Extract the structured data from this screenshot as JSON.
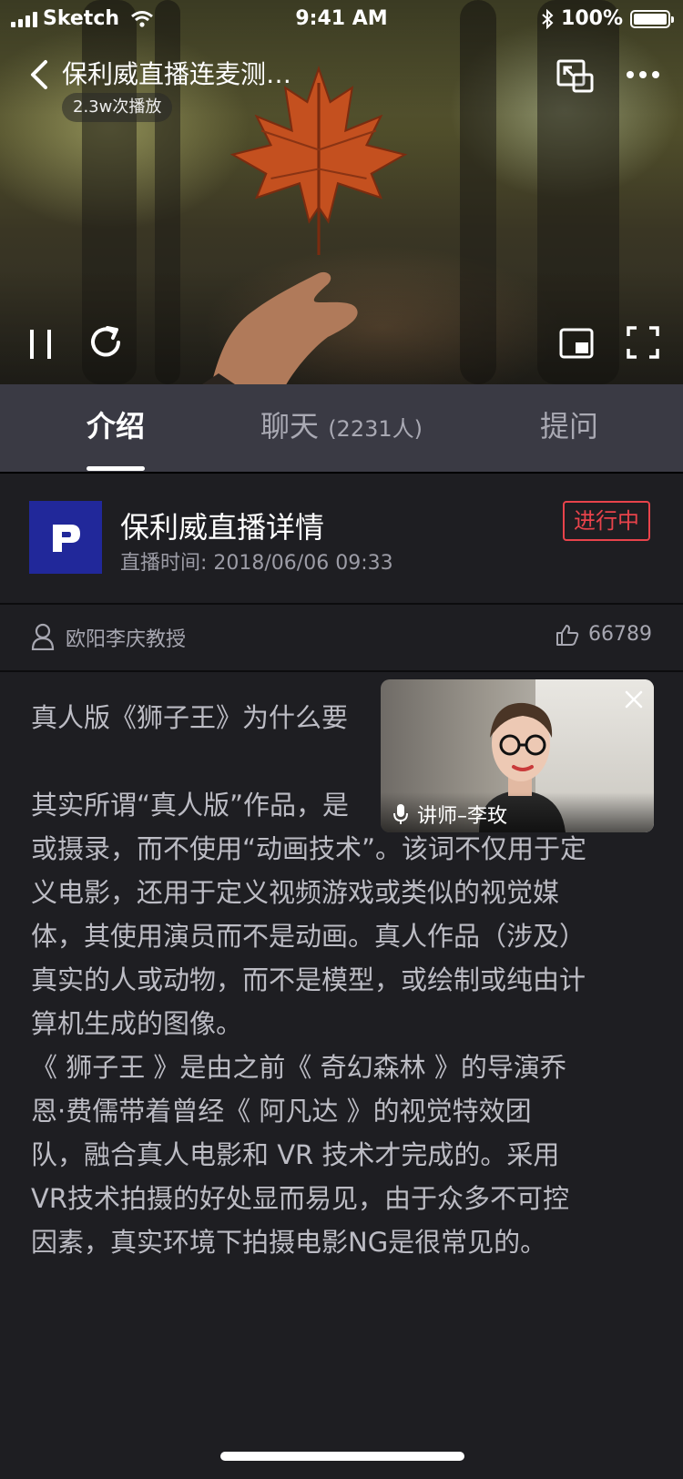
{
  "status_bar": {
    "carrier": "Sketch",
    "time": "9:41 AM",
    "battery": "100%"
  },
  "nav": {
    "title": "保利威直播连麦测…",
    "play_count": "2.3w次播放"
  },
  "tabs": [
    {
      "label": "介绍",
      "sub": ""
    },
    {
      "label": "聊天",
      "sub": "(2231人)"
    },
    {
      "label": "提问",
      "sub": ""
    }
  ],
  "detail": {
    "logo_letter": "P",
    "title": "保利威直播详情",
    "time": "直播时间: 2018/06/06 09:33",
    "status": "进行中"
  },
  "speaker": {
    "name": "欧阳李庆教授",
    "likes": "66789"
  },
  "float_video": {
    "label": "讲师–李玫"
  },
  "article": {
    "lines": [
      "真人版《狮子王》为什么要",
      "",
      "其实所谓“真人版”作品，是",
      "或摄录，而不使用“动画技术”。该词不仅用于定",
      "义电影，还用于定义视频游戏或类似的视觉媒",
      "体，其使用演员而不是动画。真人作品（涉及）",
      "真实的人或动物，而不是模型，或绘制或纯由计",
      "算机生成的图像。",
      "《 狮子王 》是由之前《 奇幻森林 》的导演乔",
      "恩·费儒带着曾经《 阿凡达 》的视觉特效团",
      "队，融合真人电影和 VR 技术才完成的。采用",
      "VR技术拍摄的好处显而易见，由于众多不可控",
      "因素，真实环境下拍摄电影NG是很常见的。"
    ]
  },
  "colors": {
    "accent_red": "#e8434b",
    "logo_blue": "#21289a",
    "tab_bg": "#3a3a44",
    "page_bg": "#1e1e22"
  },
  "icons": [
    "signal-icon",
    "wifi-icon",
    "bluetooth-icon",
    "battery-icon",
    "back-icon",
    "pip-exit-icon",
    "more-icon",
    "pause-icon",
    "replay-icon",
    "mini-window-icon",
    "fullscreen-icon",
    "user-icon",
    "thumbs-up-icon",
    "close-icon",
    "mic-icon"
  ]
}
